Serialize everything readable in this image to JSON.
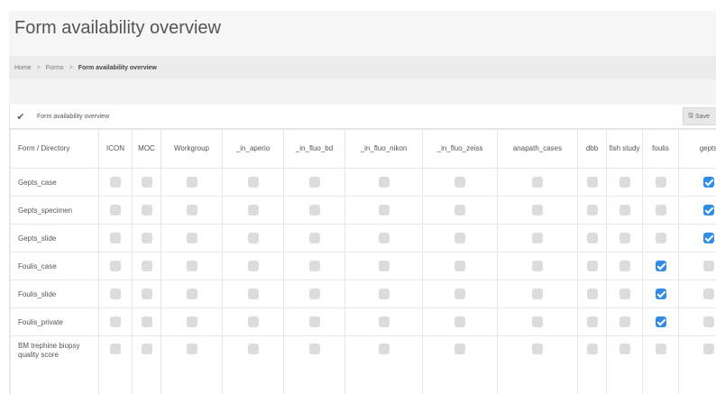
{
  "page": {
    "title": "Form availability overview"
  },
  "breadcrumb": {
    "items": [
      "Home",
      "Forms",
      "Form availability overview"
    ],
    "separator": ">"
  },
  "panel": {
    "title": "Form availability overview",
    "check_icon": "✔",
    "save_label": "Save",
    "save_icon": "🖫"
  },
  "table": {
    "columns": [
      "Form / Directory",
      "ICON",
      "MOC",
      "Workgroup",
      "_in_aperio",
      "_in_fluo_bd",
      "_in_fluo_nikon",
      "_in_fluo_zeiss",
      "anapath_cases",
      "dbb",
      "fish study",
      "foulis",
      "gepts"
    ],
    "rows": [
      {
        "name": "Gepts_case",
        "checks": [
          false,
          false,
          false,
          false,
          false,
          false,
          false,
          false,
          false,
          false,
          false,
          true
        ]
      },
      {
        "name": "Gepts_specimen",
        "checks": [
          false,
          false,
          false,
          false,
          false,
          false,
          false,
          false,
          false,
          false,
          false,
          true
        ]
      },
      {
        "name": "Gepts_slide",
        "checks": [
          false,
          false,
          false,
          false,
          false,
          false,
          false,
          false,
          false,
          false,
          false,
          true
        ]
      },
      {
        "name": "Foulis_case",
        "checks": [
          false,
          false,
          false,
          false,
          false,
          false,
          false,
          false,
          false,
          false,
          true,
          false
        ]
      },
      {
        "name": "Foulis_slide",
        "checks": [
          false,
          false,
          false,
          false,
          false,
          false,
          false,
          false,
          false,
          false,
          true,
          false
        ]
      },
      {
        "name": "Foulis_private",
        "checks": [
          false,
          false,
          false,
          false,
          false,
          false,
          false,
          false,
          false,
          false,
          true,
          false
        ]
      },
      {
        "name": "BM trephine biopsy quality score",
        "checks": [
          false,
          false,
          false,
          false,
          false,
          false,
          false,
          false,
          false,
          false,
          false,
          false
        ]
      }
    ]
  },
  "colors": {
    "checked": "#2f8de4",
    "unchecked": "#dcdcdc"
  }
}
